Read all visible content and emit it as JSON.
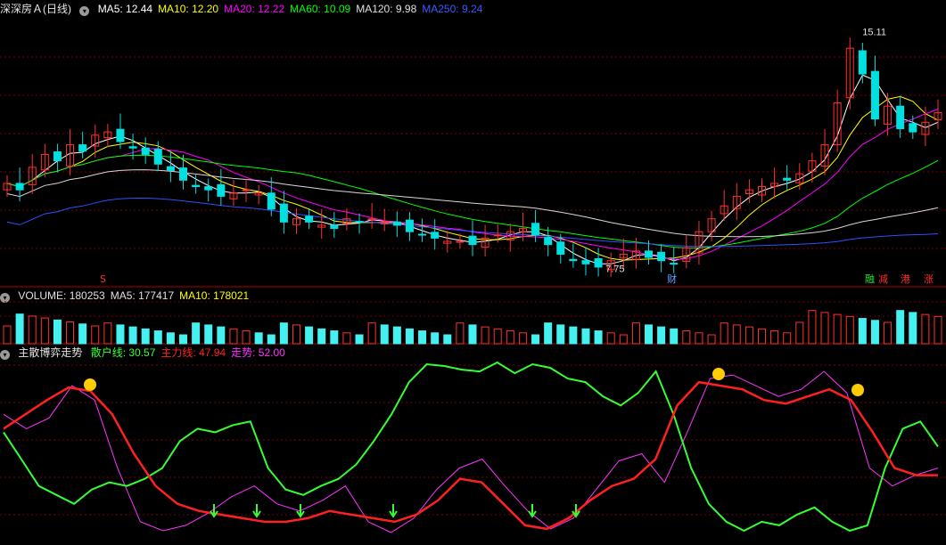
{
  "main": {
    "title": "深深房Ａ(日线)",
    "indicators": [
      {
        "label": "MA5: 12.44",
        "color": "#ffffff"
      },
      {
        "label": "MA10: 12.20",
        "color": "#ffff00"
      },
      {
        "label": "MA20: 12.22",
        "color": "#ff00ff"
      },
      {
        "label": "MA60: 10.09",
        "color": "#00ff00"
      },
      {
        "label": "MA120: 9.98",
        "color": "#e0e0e0"
      },
      {
        "label": "MA250: 9.24",
        "color": "#3a5cff"
      }
    ],
    "high_label": "15.11",
    "low_label": "7.75",
    "markers": [
      "S",
      "财",
      "融",
      "减",
      "港",
      "涨"
    ]
  },
  "volume": {
    "indicators": [
      {
        "label": "VOLUME: 180253",
        "color": "#e0e0e0"
      },
      {
        "label": "MA5: 177417",
        "color": "#e0e0e0"
      },
      {
        "label": "MA10: 178021",
        "color": "#ffff00"
      }
    ]
  },
  "osc": {
    "title": "主散博弈走势",
    "indicators": [
      {
        "label": "散户线: 30.57",
        "color": "#33ff33"
      },
      {
        "label": "主力线: 47.94",
        "color": "#ff2020"
      },
      {
        "label": "走势: 52.00",
        "color": "#ff33ff"
      }
    ]
  },
  "chart_data": {
    "type": "candlestick",
    "title": "深深房Ａ(日线)",
    "y_range_main": [
      7.3,
      15.6
    ],
    "high": 15.11,
    "low": 7.75,
    "close": [
      10.4,
      10.2,
      10.9,
      11.3,
      11.1,
      11.6,
      11.4,
      11.9,
      12.0,
      11.7,
      11.5,
      11.3,
      11.0,
      10.8,
      10.5,
      10.3,
      10.2,
      10.0,
      10.1,
      10.2,
      10.1,
      9.6,
      9.2,
      9.3,
      9.2,
      9.1,
      9.0,
      9.3,
      9.2,
      9.3,
      9.2,
      9.1,
      8.9,
      8.8,
      8.7,
      8.6,
      8.6,
      8.5,
      8.7,
      8.8,
      8.9,
      9.0,
      8.8,
      8.5,
      8.2,
      8.0,
      7.9,
      7.8,
      8.0,
      8.2,
      8.3,
      8.1,
      8.0,
      7.9,
      8.4,
      8.9,
      9.3,
      9.7,
      10.0,
      10.2,
      10.3,
      10.4,
      10.5,
      10.7,
      11.1,
      11.6,
      12.9,
      14.6,
      13.8,
      12.4,
      12.8,
      12.1,
      12.0,
      12.3,
      12.6
    ],
    "ma_values": {
      "MA5": 12.44,
      "MA10": 12.2,
      "MA20": 12.22,
      "MA60": 10.09,
      "MA120": 9.98,
      "MA250": 9.24
    },
    "volume_last": 180253,
    "volume_ma": {
      "MA5": 177417,
      "MA10": 178021
    },
    "oscillator": {
      "散户线": [
        0.6,
        0.45,
        0.3,
        0.25,
        0.2,
        0.28,
        0.32,
        0.3,
        0.34,
        0.4,
        0.55,
        0.62,
        0.6,
        0.64,
        0.66,
        0.4,
        0.28,
        0.25,
        0.3,
        0.34,
        0.42,
        0.55,
        0.7,
        0.88,
        0.98,
        0.97,
        0.95,
        0.94,
        0.99,
        0.93,
        0.98,
        0.96,
        0.9,
        0.88,
        0.8,
        0.75,
        0.82,
        0.94,
        0.7,
        0.4,
        0.2,
        0.1,
        0.05,
        0.1,
        0.08,
        0.14,
        0.18,
        0.1,
        0.05,
        0.08,
        0.4,
        0.62,
        0.66,
        0.52
      ],
      "主力线": [
        0.62,
        0.7,
        0.78,
        0.85,
        0.83,
        0.7,
        0.48,
        0.3,
        0.2,
        0.16,
        0.14,
        0.12,
        0.1,
        0.1,
        0.12,
        0.16,
        0.14,
        0.12,
        0.1,
        0.14,
        0.22,
        0.34,
        0.32,
        0.2,
        0.08,
        0.06,
        0.12,
        0.22,
        0.3,
        0.34,
        0.45,
        0.75,
        0.88,
        0.86,
        0.84,
        0.78,
        0.76,
        0.8,
        0.84,
        0.78,
        0.6,
        0.4,
        0.36,
        0.36
      ],
      "走势": [
        0.7,
        0.62,
        0.68,
        0.86,
        0.78,
        0.4,
        0.1,
        0.05,
        0.08,
        0.15,
        0.24,
        0.3,
        0.2,
        0.16,
        0.22,
        0.3,
        0.1,
        0.04,
        0.12,
        0.28,
        0.4,
        0.45,
        0.3,
        0.16,
        0.06,
        0.12,
        0.28,
        0.44,
        0.48,
        0.32,
        0.6,
        0.9,
        0.92,
        0.86,
        0.8,
        0.84,
        0.94,
        0.82,
        0.4,
        0.3,
        0.36,
        0.4
      ],
      "last": {
        "散户线": 30.57,
        "主力线": 47.94,
        "走势": 52.0
      }
    }
  }
}
